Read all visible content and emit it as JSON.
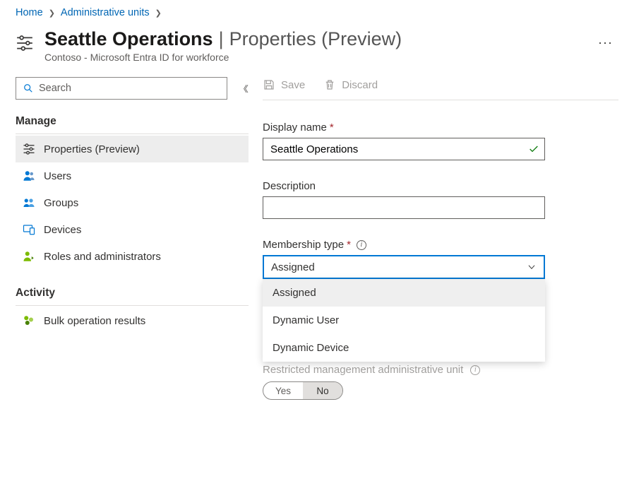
{
  "breadcrumb": {
    "home": "Home",
    "admin_units": "Administrative units"
  },
  "header": {
    "title_main": "Seattle Operations",
    "title_secondary": "Properties (Preview)",
    "subtitle": "Contoso - Microsoft Entra ID for workforce"
  },
  "sidebar": {
    "search_placeholder": "Search",
    "section_manage": "Manage",
    "section_activity": "Activity",
    "items": {
      "properties": "Properties (Preview)",
      "users": "Users",
      "groups": "Groups",
      "devices": "Devices",
      "roles": "Roles and administrators",
      "bulk": "Bulk operation results"
    }
  },
  "toolbar": {
    "save": "Save",
    "discard": "Discard"
  },
  "form": {
    "display_name_label": "Display name",
    "display_name_value": "Seattle Operations",
    "description_label": "Description",
    "description_value": "",
    "membership_type_label": "Membership type",
    "membership_type_value": "Assigned",
    "membership_options": {
      "assigned": "Assigned",
      "dynamic_user": "Dynamic User",
      "dynamic_device": "Dynamic Device"
    },
    "restricted_label": "Restricted management administrative unit",
    "toggle_yes": "Yes",
    "toggle_no": "No"
  }
}
